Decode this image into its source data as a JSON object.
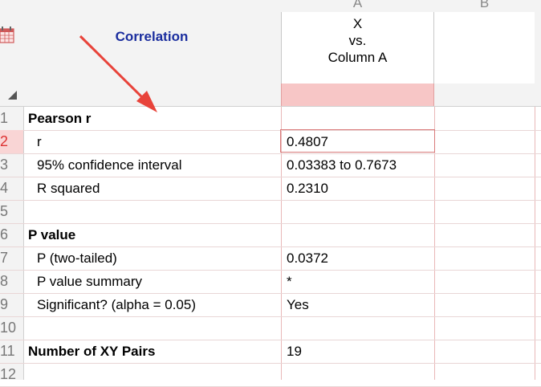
{
  "header": {
    "column_letters": [
      "A",
      "B"
    ],
    "title": "Correlation",
    "column_a_title_lines": [
      "X",
      "vs.",
      "Column A"
    ]
  },
  "rows": [
    {
      "num": "1",
      "label": "Pearson r",
      "style": "bold",
      "value": ""
    },
    {
      "num": "2",
      "label": "r",
      "style": "sub",
      "value": "0.4807"
    },
    {
      "num": "3",
      "label": "95% confidence interval",
      "style": "sub",
      "value": "0.03383 to 0.7673"
    },
    {
      "num": "4",
      "label": "R squared",
      "style": "sub",
      "value": "0.2310"
    },
    {
      "num": "5",
      "label": "",
      "style": "sub",
      "value": ""
    },
    {
      "num": "6",
      "label": "P value",
      "style": "bold",
      "value": ""
    },
    {
      "num": "7",
      "label": "P (two-tailed)",
      "style": "sub",
      "value": "0.0372"
    },
    {
      "num": "8",
      "label": "P value summary",
      "style": "sub",
      "value": "*"
    },
    {
      "num": "9",
      "label": "Significant? (alpha = 0.05)",
      "style": "sub",
      "value": "Yes"
    },
    {
      "num": "10",
      "label": "",
      "style": "sub",
      "value": ""
    },
    {
      "num": "11",
      "label": "Number of XY Pairs",
      "style": "bold",
      "value": "19"
    },
    {
      "num": "12",
      "label": "",
      "style": "sub",
      "value": ""
    }
  ],
  "selected_row": "2",
  "colors": {
    "title_color": "#1a2d9e",
    "selection_fill": "#f7c6c6",
    "arrow": "#e8433a"
  },
  "icons": {
    "table_icon": "table-grid-icon",
    "arrow": "red-pointer-arrow"
  }
}
